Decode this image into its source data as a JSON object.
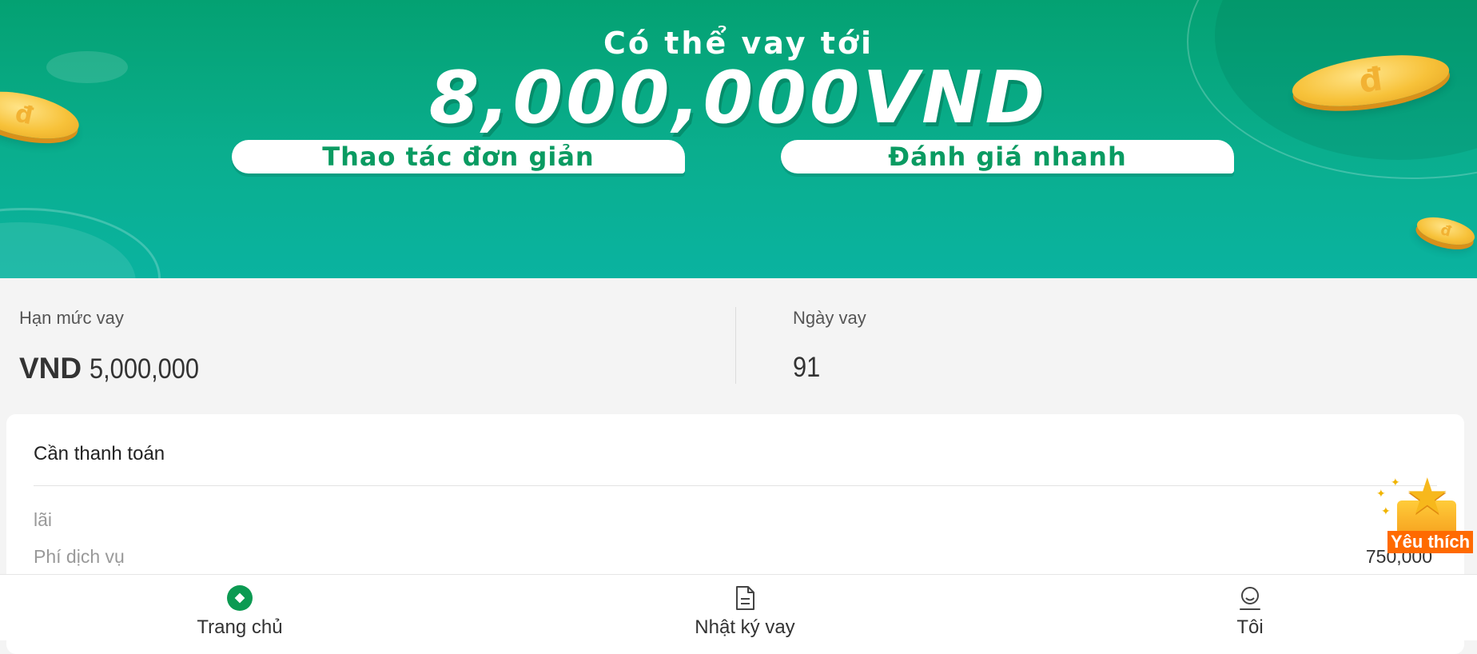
{
  "banner": {
    "subtitle": "Có thể vay tới",
    "amount": "8,000,000VND",
    "features": [
      "Thao tác đơn giản",
      "Đánh giá nhanh"
    ],
    "coin_symbol": "đ"
  },
  "loan_limit": {
    "label": "Hạn mức vay",
    "currency": "VND",
    "amount": "5,000,000"
  },
  "loan_days": {
    "label": "Ngày vay",
    "value": "91"
  },
  "payment": {
    "title": "Cần thanh toán",
    "rows": [
      {
        "label": "lãi",
        "value": ""
      },
      {
        "label": "Phí dịch vụ",
        "value": "750,000"
      }
    ]
  },
  "favorite_badge": {
    "label": "Yêu thích"
  },
  "bottom_nav": {
    "items": [
      {
        "label": "Trang chủ",
        "icon": "home-icon",
        "active": true
      },
      {
        "label": "Nhật ký vay",
        "icon": "document-icon",
        "active": false
      },
      {
        "label": "Tôi",
        "icon": "profile-icon",
        "active": false
      }
    ]
  },
  "colors": {
    "brand_green": "#05a472",
    "accent_orange": "#ff6a00",
    "coin_gold": "#f7c23a"
  }
}
